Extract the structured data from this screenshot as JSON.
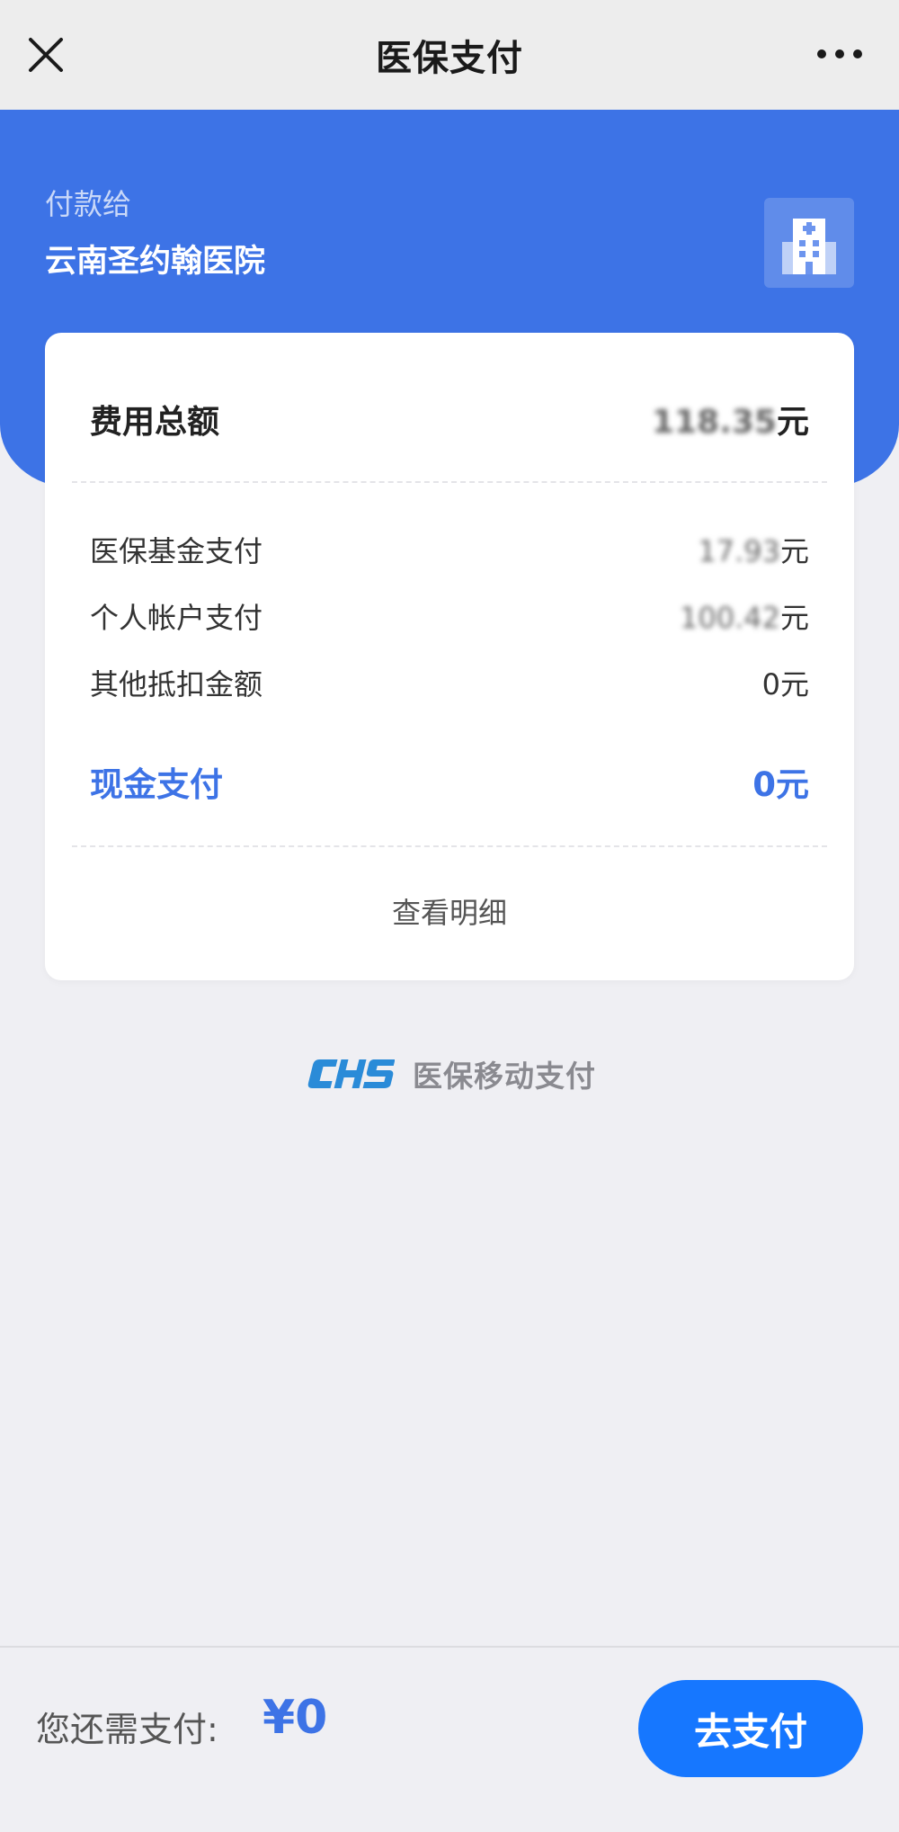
{
  "navbar": {
    "title": "医保支付"
  },
  "payee": {
    "caption": "付款给",
    "name": "云南圣约翰医院"
  },
  "bill": {
    "total": {
      "label": "费用总额",
      "value": "118.35",
      "unit": "元"
    },
    "items": [
      {
        "label": "医保基金支付",
        "value": "17.93",
        "unit": "元",
        "blurred": true
      },
      {
        "label": "个人帐户支付",
        "value": "100.42",
        "unit": "元",
        "blurred": true
      },
      {
        "label": "其他抵扣金额",
        "value": "0",
        "unit": "元",
        "blurred": false
      }
    ],
    "cash": {
      "label": "现金支付",
      "value": "0",
      "unit": "元"
    },
    "detail_link": "查看明细"
  },
  "brand": {
    "logo_text": "CHS",
    "name": "医保移动支付"
  },
  "bottom": {
    "remain_label": "您还需支付:",
    "remain_value": "¥0",
    "pay_button": "去支付"
  },
  "colors": {
    "primary": "#3d73e6",
    "button": "#1677ff",
    "logo": "#2a8bd8"
  },
  "icons": {
    "close": "close-icon",
    "more": "more-icon",
    "hospital": "hospital-icon"
  }
}
